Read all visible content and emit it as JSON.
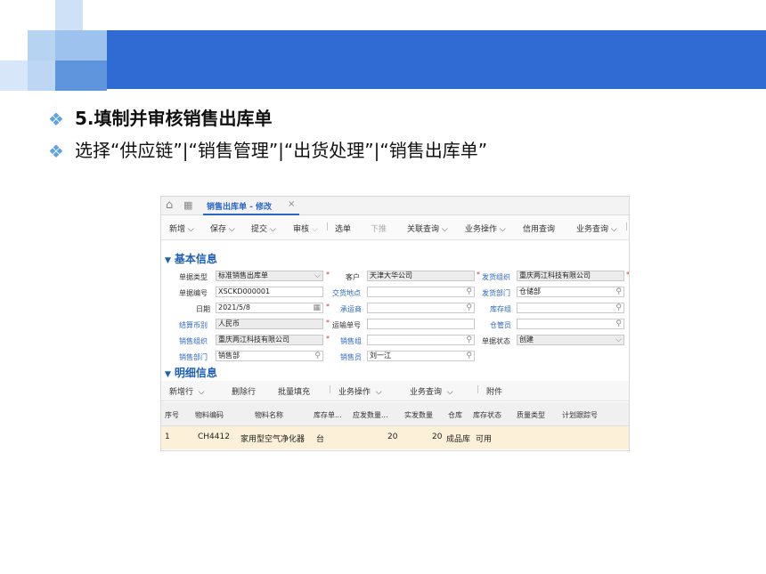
{
  "slide": {
    "line1": "5.填制并审核销售出库单",
    "line2": "选择“供应链”|“销售管理”|“出货处理”|“销售出库单”",
    "bullet": "❖",
    "accent": "#2f6bd2"
  },
  "app": {
    "home_icon": "⌂",
    "grid_icon": "▦",
    "tab_label": "销售出库单 - 修改",
    "tab_close": "×",
    "toolbar": {
      "new": "新增",
      "save": "保存",
      "submit": "提交",
      "audit": "审核",
      "select": "选单",
      "push": "下推",
      "related": "关联查询",
      "business": "业务操作",
      "credit": "信用查询",
      "biz_query": "业务查询"
    },
    "section_basic": "基本信息",
    "section_detail": "明细信息",
    "fields": {
      "bill_type_label": "单据类型",
      "bill_type_value": "标准销售出库单",
      "bill_no_label": "单据编号",
      "bill_no_value": "XSCKD000001",
      "date_label": "日期",
      "date_value": "2021/5/8",
      "currency_label": "结算币别",
      "currency_value": "人民币",
      "sales_org_label": "销售组织",
      "sales_org_value": "重庆两江科技有限公司",
      "sales_dept_label": "销售部门",
      "sales_dept_value": "销售部",
      "customer_label": "客户",
      "customer_value": "天津大华公司",
      "delivery_place_label": "交货地点",
      "delivery_place_value": "",
      "carrier_label": "承运商",
      "carrier_value": "",
      "waybill_label": "运输单号",
      "waybill_value": "",
      "sales_group_label": "销售组",
      "sales_group_value": "",
      "salesman_label": "销售员",
      "salesman_value": "刘一江",
      "ship_org_label": "发货组织",
      "ship_org_value": "重庆两江科技有限公司",
      "ship_dept_label": "发货部门",
      "ship_dept_value": "仓储部",
      "stock_group_label": "库存组",
      "stock_group_value": "",
      "keeper_label": "仓管员",
      "keeper_value": "",
      "status_label": "单据状态",
      "status_value": "创建"
    },
    "detail_toolbar": {
      "add_row": "新增行",
      "delete_row": "删除行",
      "batch_fill": "批量填充",
      "business": "业务操作",
      "biz_query": "业务查询",
      "attachment": "附件"
    },
    "table": {
      "headers": [
        "序号",
        "物料编码",
        "物料名称",
        "库存单...",
        "应发数量...",
        "实发数量",
        "仓库",
        "库存状态",
        "质量类型",
        "计划跟踪号"
      ],
      "rows": [
        [
          "1",
          "CH4412",
          "家用型空气净化器",
          "台",
          "20",
          "20",
          "成品库",
          "可用",
          "",
          ""
        ]
      ]
    }
  }
}
